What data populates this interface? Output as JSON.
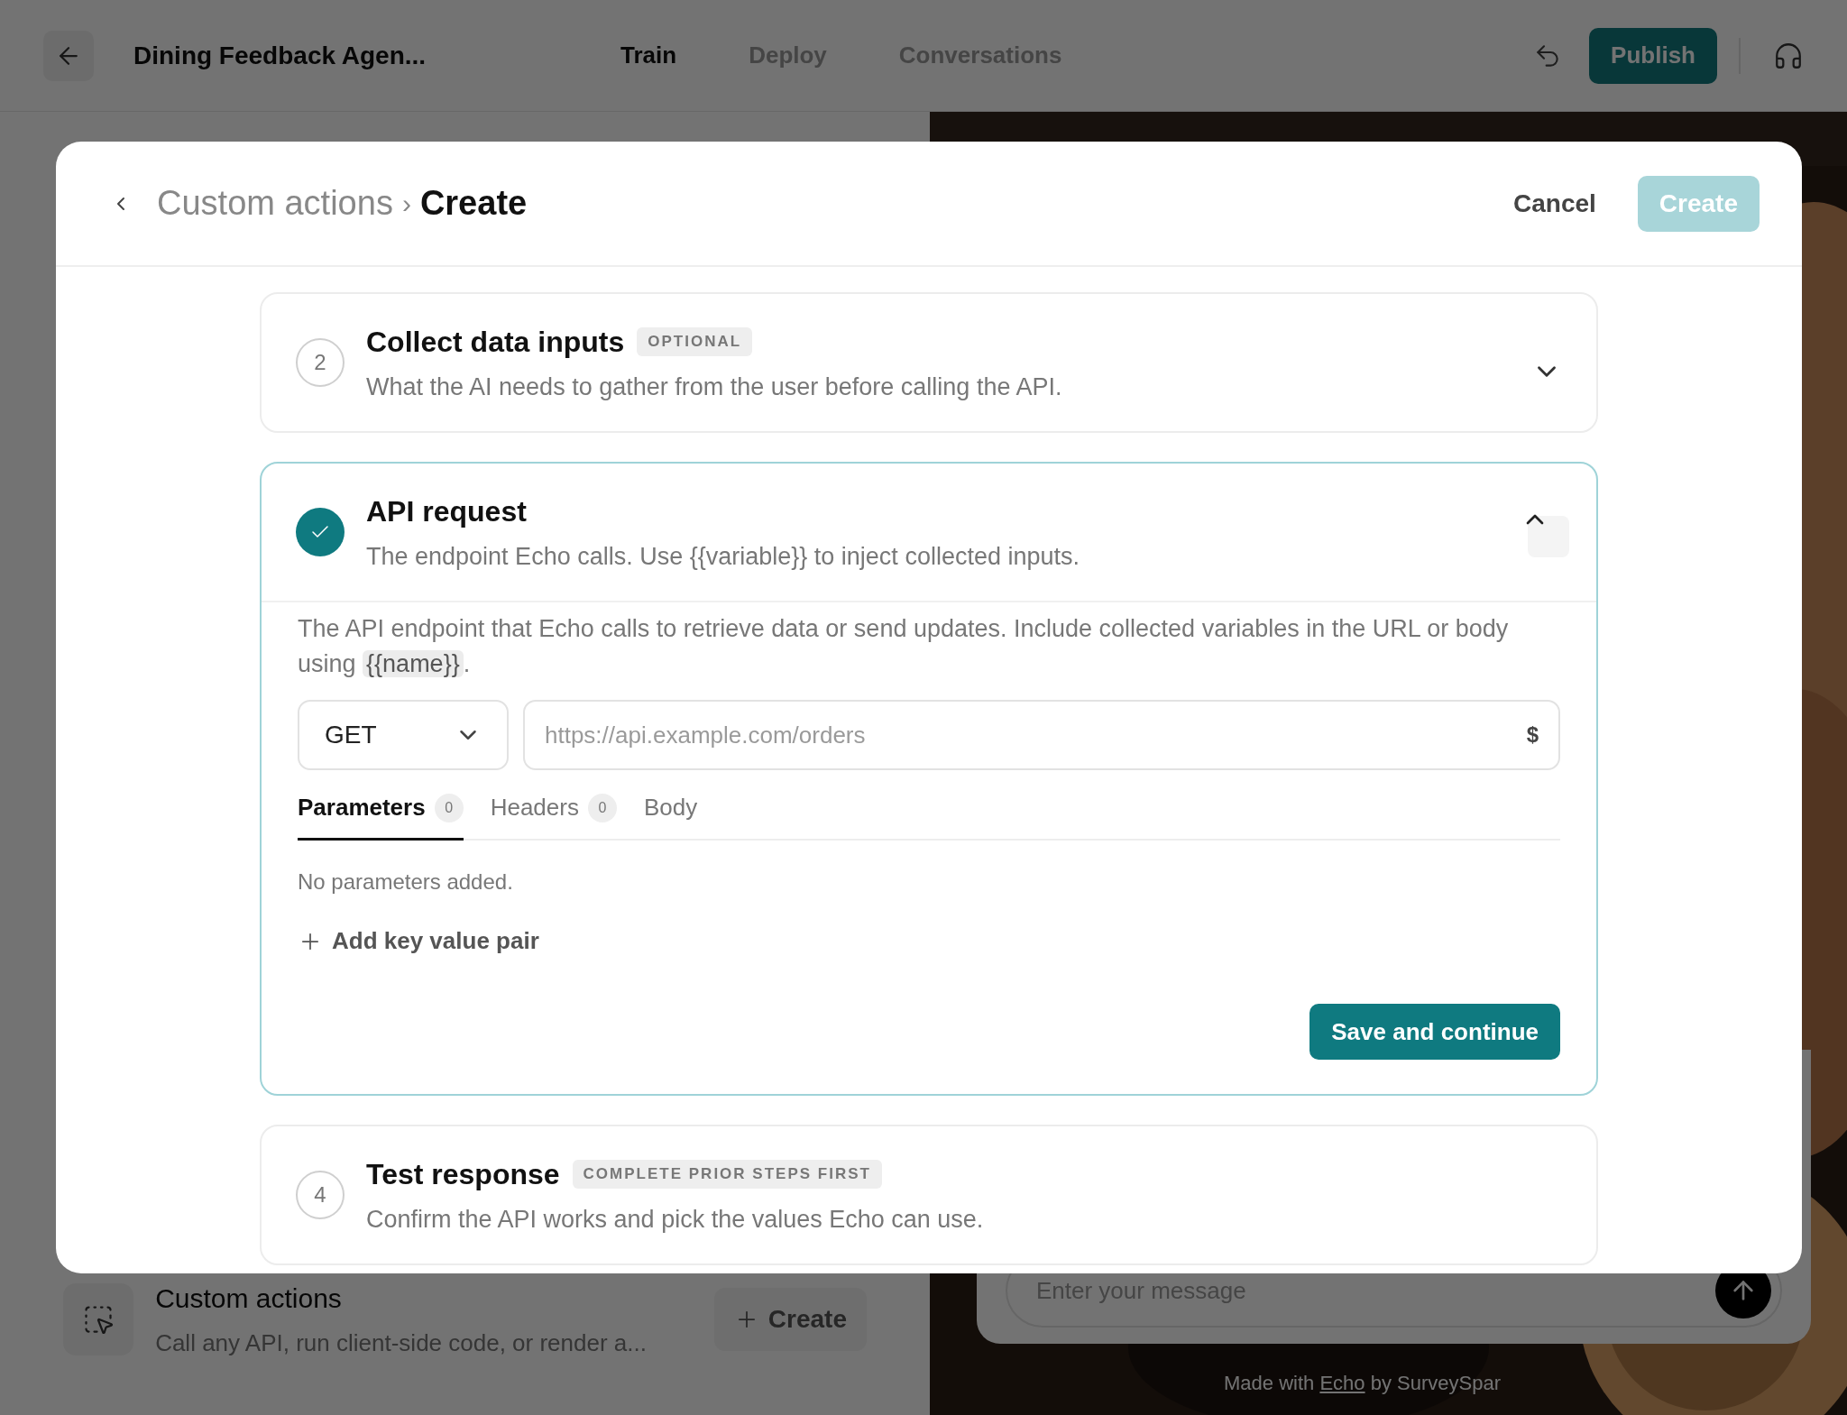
{
  "app_bar": {
    "title": "Dining Feedback Agen...",
    "tabs": [
      {
        "label": "Train",
        "selected": true
      },
      {
        "label": "Deploy",
        "selected": false
      },
      {
        "label": "Conversations",
        "selected": false
      }
    ],
    "publish_button": "Publish"
  },
  "custom_actions_card": {
    "title": "Custom actions",
    "description": "Call any API, run client-side code, or render a...",
    "create_button": "Create"
  },
  "chat_preview": {
    "placeholder": "Enter your message",
    "footer_prefix": "Made with",
    "footer_link": "Echo",
    "footer_suffix": "by SurveySpar"
  },
  "modal": {
    "breadcrumb_parent": "Custom actions",
    "breadcrumb_separator": "›",
    "breadcrumb_current": "Create",
    "cancel_button": "Cancel",
    "create_button": {
      "label": "Create",
      "disabled": true
    },
    "steps": [
      {
        "number": "2",
        "completed": false,
        "locked": false,
        "expanded": false,
        "title": "Collect data inputs",
        "badge": "OPTIONAL",
        "description": "What the AI needs to gather from the user before calling the API."
      },
      {
        "completed": true,
        "expanded": true,
        "title": "API request",
        "description": "The endpoint Echo calls. Use {{variable}} to inject collected inputs.",
        "body": {
          "intro": "The API endpoint that Echo calls to retrieve data or send updates. Include collected variables in the URL or body using",
          "intro_code": "{{name}}",
          "intro_end": ".",
          "method": "GET",
          "url_placeholder": "https://api.example.com/orders",
          "url_suffix": "$",
          "tabs": [
            {
              "label": "Parameters",
              "count": "0",
              "selected": true
            },
            {
              "label": "Headers",
              "count": "0",
              "selected": false
            },
            {
              "label": "Body",
              "selected": false
            }
          ],
          "empty_text": "No parameters added.",
          "add_button": "Add key value pair",
          "save_button": "Save and continue"
        }
      },
      {
        "number": "4",
        "completed": false,
        "locked": true,
        "expanded": false,
        "title": "Test response",
        "badge": "COMPLETE PRIOR STEPS FIRST",
        "description": "Confirm the API works and pick the values Echo can use."
      }
    ]
  }
}
